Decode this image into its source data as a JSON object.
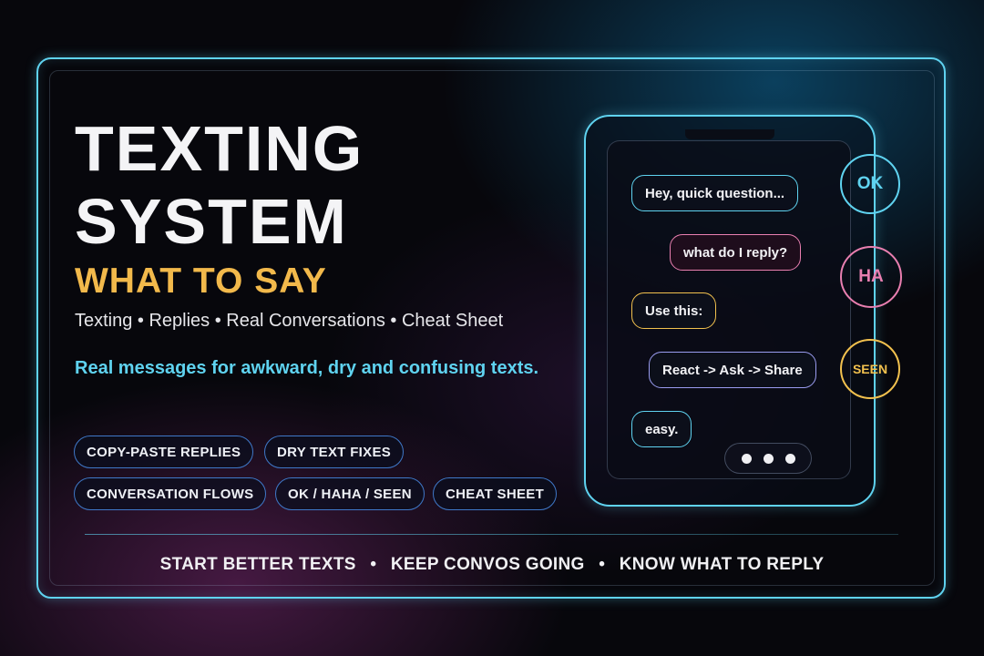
{
  "hero": {
    "title_line1": "TEXTING",
    "title_line2": "SYSTEM",
    "subtitle": "WHAT TO SAY",
    "topics": "Texting • Replies • Real Conversations • Cheat Sheet",
    "tagline": "Real messages for awkward, dry and confusing texts."
  },
  "chips": [
    "COPY-PASTE REPLIES",
    "DRY TEXT FIXES",
    "CONVERSATION FLOWS",
    "OK / HAHA / SEEN",
    "CHEAT SHEET"
  ],
  "phone": {
    "messages": [
      {
        "text": "Hey, quick question...",
        "color": "#5fd3f0"
      },
      {
        "text": "what do I reply?",
        "color": "#e97fb0"
      },
      {
        "text": "Use this:",
        "color": "#f2c14e"
      },
      {
        "text": "React -> Ask -> Share",
        "color": "#9a9cf0"
      },
      {
        "text": "easy.",
        "color": "#5fd3f0"
      }
    ]
  },
  "badges": [
    {
      "label": "OK",
      "color": "#5fd3f0"
    },
    {
      "label": "HA",
      "color": "#e97fb0"
    },
    {
      "label": "SEEN",
      "color": "#f2c14e"
    }
  ],
  "footer": {
    "item1": "START BETTER TEXTS",
    "item2": "KEEP CONVOS GOING",
    "item3": "KNOW WHAT TO REPLY",
    "separator": "•"
  },
  "colors": {
    "accent_cyan": "#5fd3f0",
    "accent_gold": "#f2b94b",
    "chip_border": "#3f78c8",
    "background": "#07070c"
  }
}
